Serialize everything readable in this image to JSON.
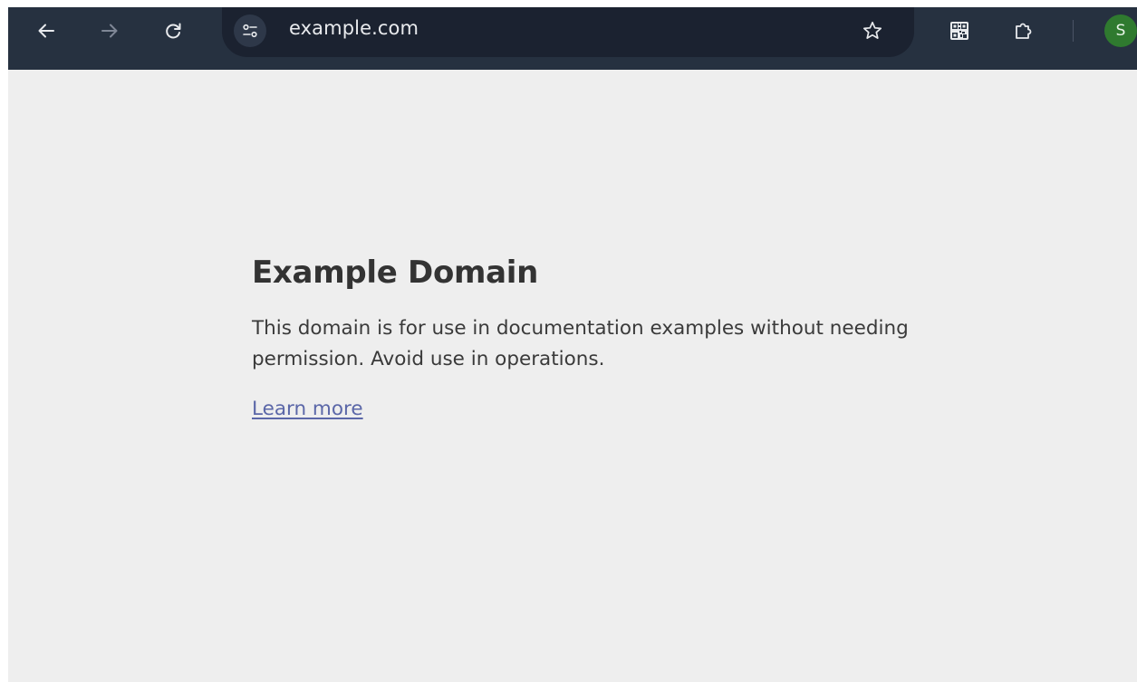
{
  "browser": {
    "url": "example.com",
    "profile_initial": "S",
    "icons": {
      "back": "arrow-left-icon",
      "forward": "arrow-right-icon",
      "reload": "reload-icon",
      "site_info": "tune-icon",
      "bookmark": "star-outline-icon",
      "qr": "qr-code-icon",
      "extensions": "puzzle-piece-icon"
    },
    "colors": {
      "toolbar": "#263140",
      "omnibox": "#1b2230",
      "avatar": "#2f7a2f",
      "page_background": "#eeeeee",
      "link": "#5b67a8"
    }
  },
  "page": {
    "title": "Example Domain",
    "description": "This domain is for use in documentation examples without needing permission. Avoid use in operations.",
    "link_label": "Learn more"
  }
}
